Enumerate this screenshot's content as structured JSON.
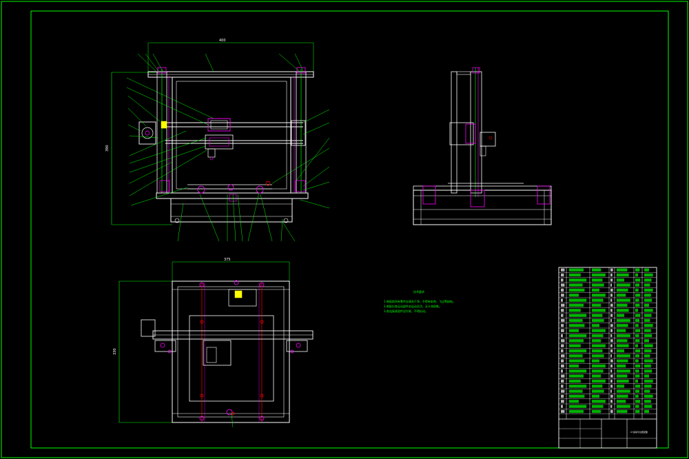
{
  "drawing": {
    "background": "#000000",
    "line_white": "#ffffff",
    "line_green": "#00ff00",
    "line_magenta": "#ff00ff",
    "line_red": "#ff0000",
    "line_yellow": "#ffff00"
  },
  "front_view": {
    "width_dim": "400",
    "height_dim": "390"
  },
  "top_view": {
    "width_dim": "375",
    "height_dim": "330"
  },
  "notes": {
    "title": "技术要求",
    "lines": [
      "1.装配前所有零件应清洗干净，不得有毛刺、飞边等缺陷。",
      "2.装配后各运动部件应运动灵活，无卡滞现象。",
      "3.各连接紧固件应拧紧，不得松动。"
    ]
  },
  "title_block": {
    "drawing_name": "XY运动平台装配图"
  }
}
